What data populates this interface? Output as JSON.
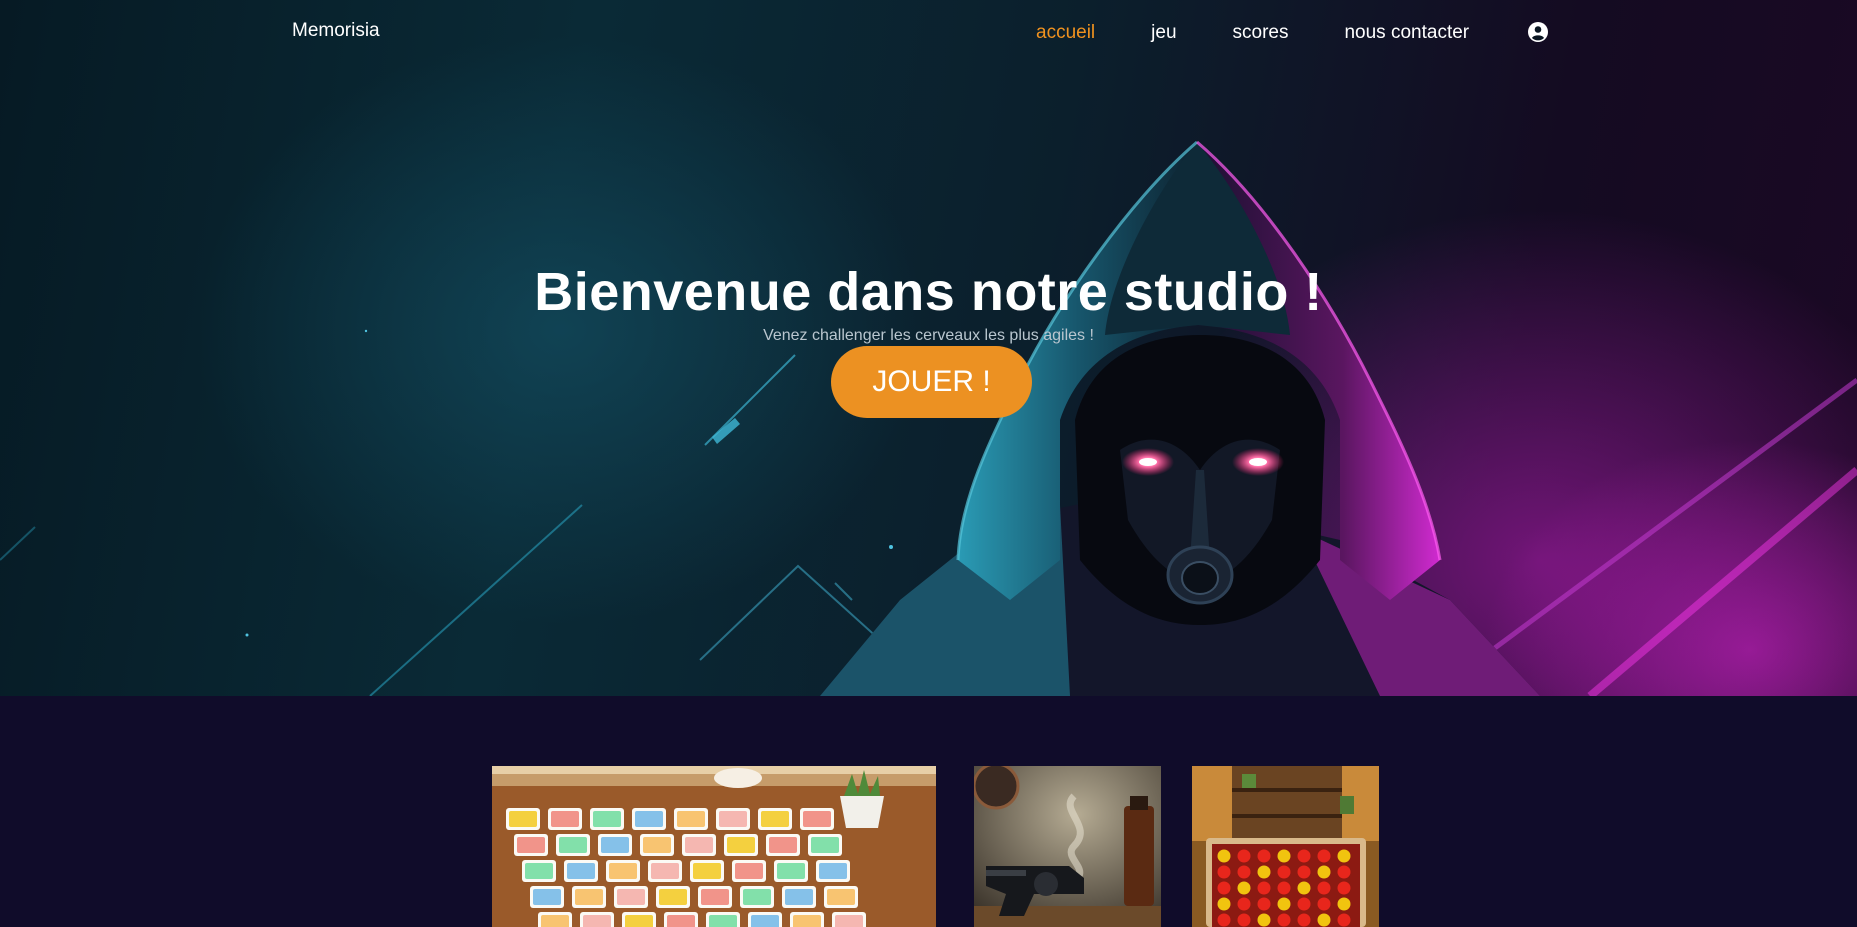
{
  "nav": {
    "brand": "Memorisia",
    "links": [
      {
        "label": "accueil",
        "active": true
      },
      {
        "label": "jeu",
        "active": false
      },
      {
        "label": "scores",
        "active": false
      },
      {
        "label": "nous contacter",
        "active": false
      }
    ],
    "user_icon": "user-circle-icon"
  },
  "hero": {
    "title": "Bienvenue dans notre studio !",
    "subtitle": "Venez challenger les cerveaux les plus agiles !",
    "cta_label": "JOUER !"
  },
  "games": [
    {
      "name": "memory-cards-image"
    },
    {
      "name": "revolver-image"
    },
    {
      "name": "connect-four-image"
    }
  ],
  "colors": {
    "accent": "#ec9122",
    "active_link": "#f0921f",
    "background": "#100c2a"
  }
}
